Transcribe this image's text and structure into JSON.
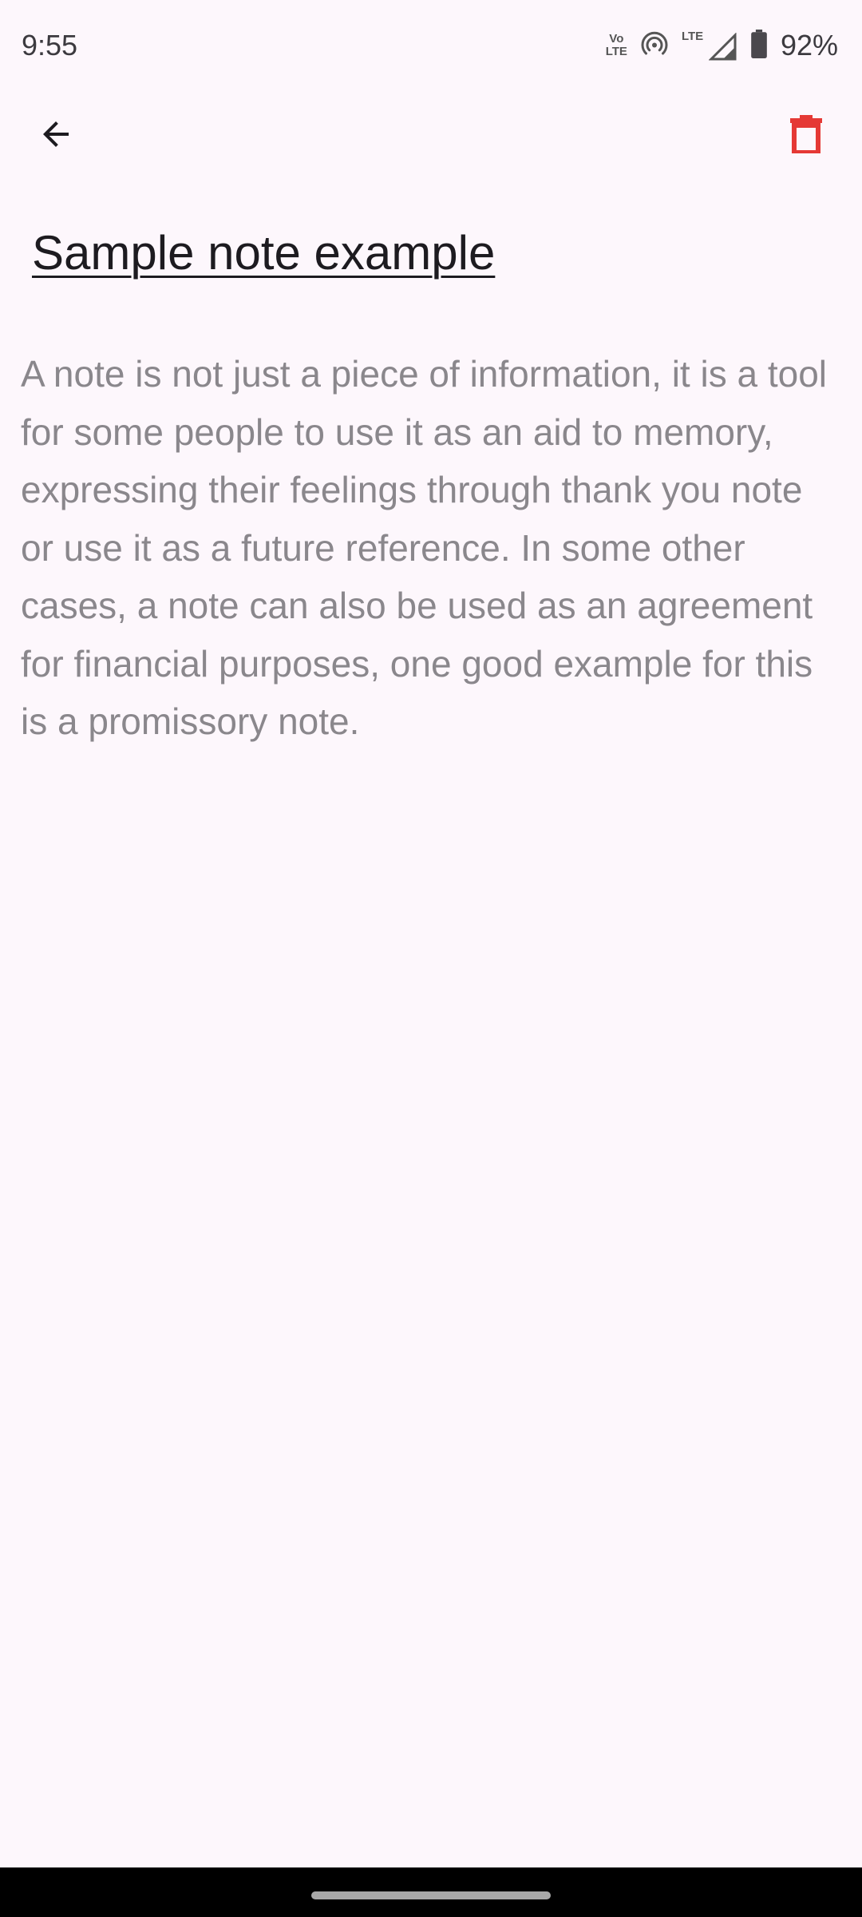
{
  "status_bar": {
    "time": "9:55",
    "volte_top": "Vo",
    "volte_bottom": "LTE",
    "lte_label": "LTE",
    "battery_percent": "92%",
    "icons": [
      "volte-icon",
      "hotspot-icon",
      "lte-signal-icon",
      "battery-icon"
    ]
  },
  "app_bar": {
    "back_icon": "arrow-back-icon",
    "delete_icon": "trash-icon",
    "delete_color": "#e53935"
  },
  "note": {
    "title": "Sample note example",
    "body": "A note is not just a piece of information, it is a tool for some people to use it as an aid to memory, expressing their feelings through thank you note or use it as a future reference. In some other cases, a note can also be used as an agreement for financial purposes, one good example for this is a promissory note."
  },
  "colors": {
    "background": "#fdf7fc",
    "title_text": "#1d1b20",
    "body_text": "#8a878c"
  }
}
